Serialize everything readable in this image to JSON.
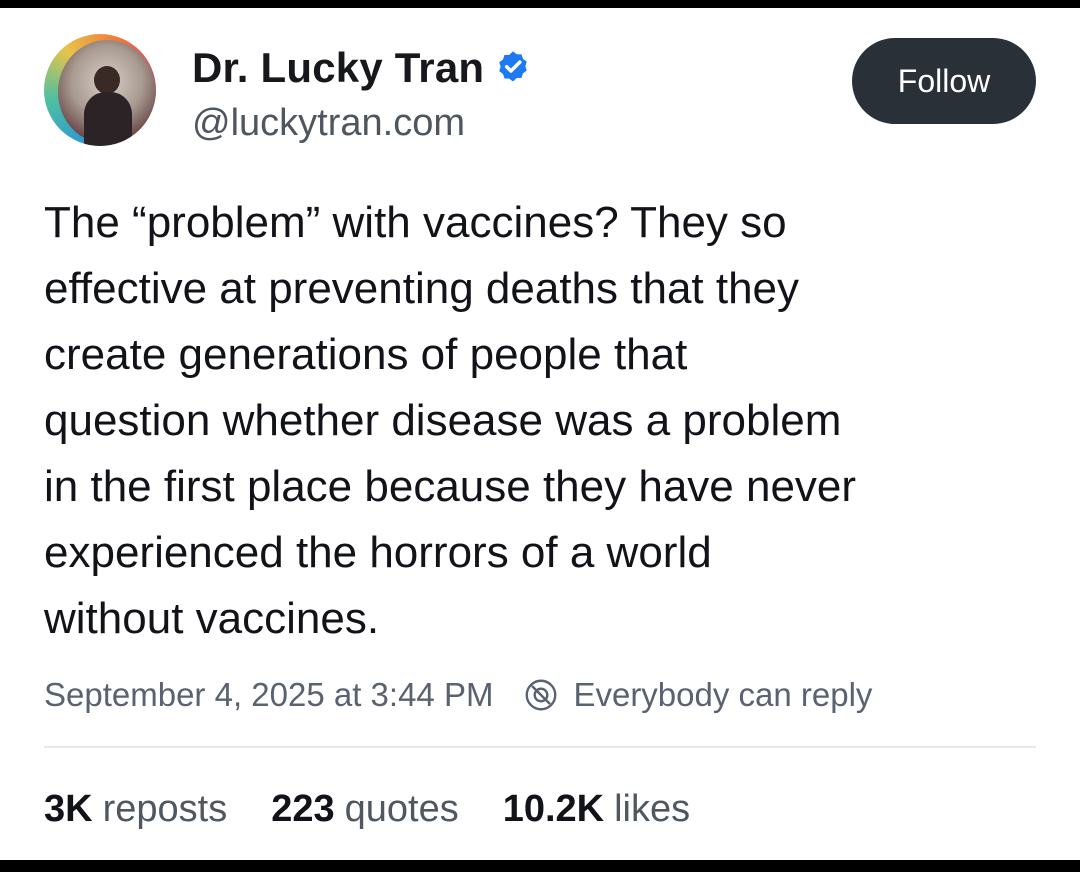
{
  "author": {
    "display_name": "Dr. Lucky Tran",
    "handle": "@luckytran.com",
    "verified": true,
    "avatar_icon": "profile-photo"
  },
  "follow_button": {
    "label": "Follow"
  },
  "post": {
    "lines": [
      "The “problem” with vaccines? They so",
      "effective at preventing deaths that they",
      "create generations of people that",
      "question whether disease was a problem",
      "in the first place because they have never",
      "experienced the horrors of a world",
      "without vaccines."
    ]
  },
  "meta": {
    "timestamp": "September 4, 2025 at 3:44 PM",
    "reply_setting": "Everybody can reply",
    "reply_icon": "reply-restriction-icon"
  },
  "stats": {
    "reposts": {
      "count": "3K",
      "label": "reposts"
    },
    "quotes": {
      "count": "223",
      "label": "quotes"
    },
    "likes": {
      "count": "10.2K",
      "label": "likes"
    }
  },
  "colors": {
    "follow_bg": "#2a3038",
    "verified_blue": "#1d7af0",
    "text_primary": "#111318",
    "text_secondary": "#5a6270"
  }
}
